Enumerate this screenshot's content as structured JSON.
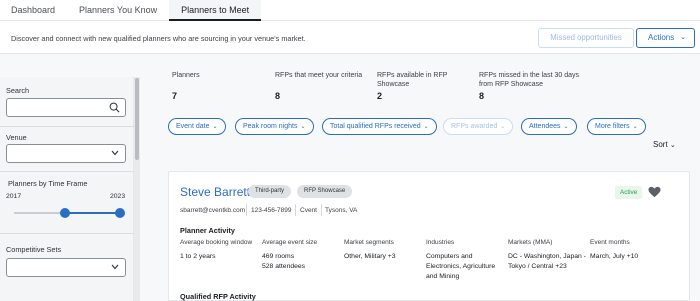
{
  "tabs": [
    {
      "label": "Dashboard"
    },
    {
      "label": "Planners You Know"
    },
    {
      "label": "Planners to Meet"
    }
  ],
  "subbar": {
    "description": "Discover and connect with new qualified planners who are sourcing in your venue's market.",
    "missed_label": "Missed opportunities",
    "actions_label": "Actions"
  },
  "sidebar": {
    "search_label": "Search",
    "search_value": "",
    "venue_label": "Venue",
    "venue_value": "",
    "timeframe_label": "Planners by Time Frame",
    "timeframe_start": "2017",
    "timeframe_end": "2023",
    "slider_low_fraction": 0.5,
    "slider_high_fraction": 1.0,
    "competitive_label": "Competitive Sets",
    "competitive_value": ""
  },
  "stats": [
    {
      "label": "Planners",
      "value": "7"
    },
    {
      "label": "RFPs that meet your criteria",
      "value": "8"
    },
    {
      "label": "RFPs available in RFP Showcase",
      "value": "2"
    },
    {
      "label": "RFPs missed in the last 30 days from RFP Showcase",
      "value": "8"
    }
  ],
  "filters": [
    {
      "label": "Event date",
      "enabled": true
    },
    {
      "label": "Peak room nights",
      "enabled": true
    },
    {
      "label": "Total qualified RFPs received",
      "enabled": true
    },
    {
      "label": "RFPs awarded",
      "enabled": false
    },
    {
      "label": "Attendees",
      "enabled": true
    },
    {
      "label": "More filters",
      "enabled": true
    }
  ],
  "sort_label": "Sort",
  "planner": {
    "name": "Steve Barrett",
    "tags": [
      "Third-party",
      "RFP Showcase"
    ],
    "status": "Active",
    "email": "sbarrett@cventkb.com",
    "phone": "123-456-7899",
    "company": "Cvent",
    "location": "Tysons, VA",
    "activity_title": "Planner Activity",
    "columns": [
      {
        "header": "Average booking window",
        "value": "1 to 2 years"
      },
      {
        "header": "Average event size",
        "value": "469 rooms\n528 attendees"
      },
      {
        "header": "Market segments",
        "value": "Other, Military +3"
      },
      {
        "header": "Industries",
        "value": "Computers and Electronics, Agriculture and Mining"
      },
      {
        "header": "Markets (MMA)",
        "value": "DC - Washington, Japan - Tokyo / Central +23"
      },
      {
        "header": "Event months",
        "value": "March, July +10"
      }
    ],
    "rfp_title": "Qualified RFP Activity"
  },
  "colors": {
    "accent": "#2a6dc4",
    "active_green": "#2c9a4d",
    "heart": "#5b5f66"
  }
}
